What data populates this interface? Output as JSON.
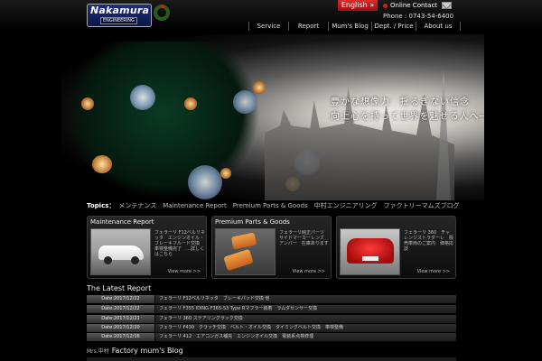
{
  "header": {
    "logo_name": "Nakamura",
    "logo_sub": "ENGINEERING",
    "lang_label": "English »",
    "contact_label": "Online Contact",
    "phone": "Phone : 0743-54-6400",
    "nav": [
      "Service",
      "Report",
      "Mum's Blog",
      "Dept. / Price",
      "About us"
    ]
  },
  "hero": {
    "tagline_line1": "豊かな想像力　揺るぎない信念",
    "tagline_line2": "向上心を持って世界を魅せる人へ──。"
  },
  "topics": {
    "label": "Topics：",
    "text": "メンテナンス　Maintenance Report　Premium Parts & Goods　中村エンジニアリング　ファクトリーマムズブログ"
  },
  "cards": [
    {
      "title": "Maintenance Report",
      "text": "フェラーリ F12ベルリネッタ　エンジンオイル・ブレーキフルード交換　車検整備完了　…詳しくはこちら",
      "view_more": "View more >>"
    },
    {
      "title": "Premium Parts & Goods",
      "text": "フェラーリ純正パーツ　サイドマーカーレンズ　アンバー　在庫あります",
      "view_more": "View more >>"
    },
    {
      "title": "",
      "text": "フェラーリ 360　チャレンジストラダーレ　販売車両のご案内　価格応談",
      "view_more": "View more >>"
    }
  ],
  "latest": {
    "title": "The Latest Report",
    "rows": [
      {
        "date": "Date:2017/12/22",
        "title": "フェラーリ F12ベルリネッタ　ブレーキパッド交換 他"
      },
      {
        "date": "Date:2017/12/22",
        "title": "フェラーリ F355 IDING F365-S3 Type Rマフラー装着　ラムダセンサー交換"
      },
      {
        "date": "Date:2017/12/21",
        "title": "フェラーリ 360 ステアリングラック交換"
      },
      {
        "date": "Date:2017/12/20",
        "title": "フェラーリ F430　クラッチ交換　ベルト・オイル交換　タイミングベルト交換　車検整備"
      },
      {
        "date": "Date:2017/12/16",
        "title": "フェラーリ 412　エアコンガス補充　エンジンオイル交換　電装系点検修理"
      }
    ]
  },
  "blog": {
    "prefix": "Mrs.中村",
    "title": "Factory mum's Blog"
  },
  "colors": {
    "accent_red": "#c3251d",
    "background": "#000000",
    "logo_blue": "#1e2f7a"
  }
}
